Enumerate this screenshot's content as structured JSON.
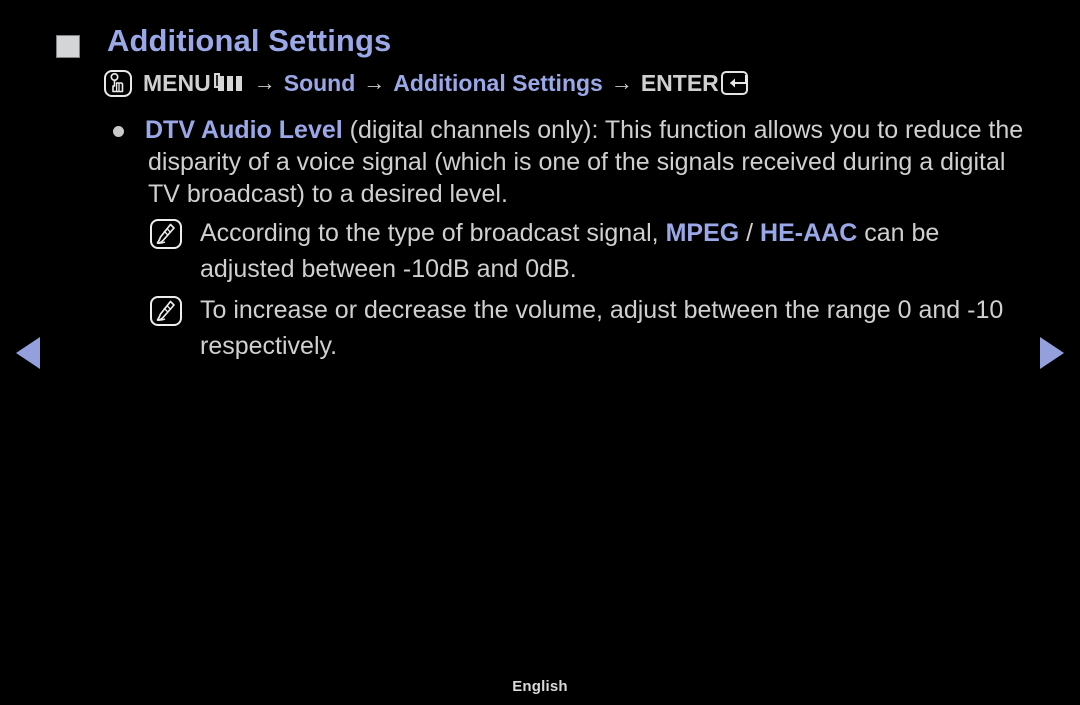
{
  "theme": {
    "background": "#000000",
    "accent": "#9aa8e8",
    "body_text": "#d0d0d0",
    "bullet_square": "#d3d5d6",
    "nav_arrow": "#93a0dd"
  },
  "header": {
    "title": "Additional Settings",
    "square_bullet_icon": "filled-square-icon"
  },
  "menu_path": {
    "press_icon": "menu-press-hand-icon",
    "menu_label": "MENU",
    "menu_grid_icon": "menu-grid-icon",
    "arrow_1": "→",
    "sound_label": "Sound",
    "arrow_2": "→",
    "additional_settings_label": "Additional Settings",
    "arrow_3": "→",
    "enter_label": "ENTER",
    "enter_icon": "enter-return-icon"
  },
  "content": {
    "bullet": {
      "dot_icon": "bullet-dot-icon",
      "keyword": "DTV Audio Level",
      "text": " (digital channels only): This function allows you to reduce the disparity of a voice signal (which is one of the signals received during a digital TV broadcast) to a desired level."
    },
    "notes": [
      {
        "icon": "note-pen-icon",
        "text_before": "According to the type of broadcast signal, ",
        "keyword_1": "MPEG",
        "separator": " / ",
        "keyword_2": "HE-AAC",
        "text_after": " can be adjusted between -10dB and 0dB."
      },
      {
        "icon": "note-pen-icon",
        "text_before": "To increase or decrease the volume, adjust between the range 0 and -10 respectively.",
        "keyword_1": "",
        "separator": "",
        "keyword_2": "",
        "text_after": ""
      }
    ]
  },
  "navigation": {
    "prev_icon": "prev-triangle-icon",
    "next_icon": "next-triangle-icon"
  },
  "footer": {
    "language": "English"
  }
}
